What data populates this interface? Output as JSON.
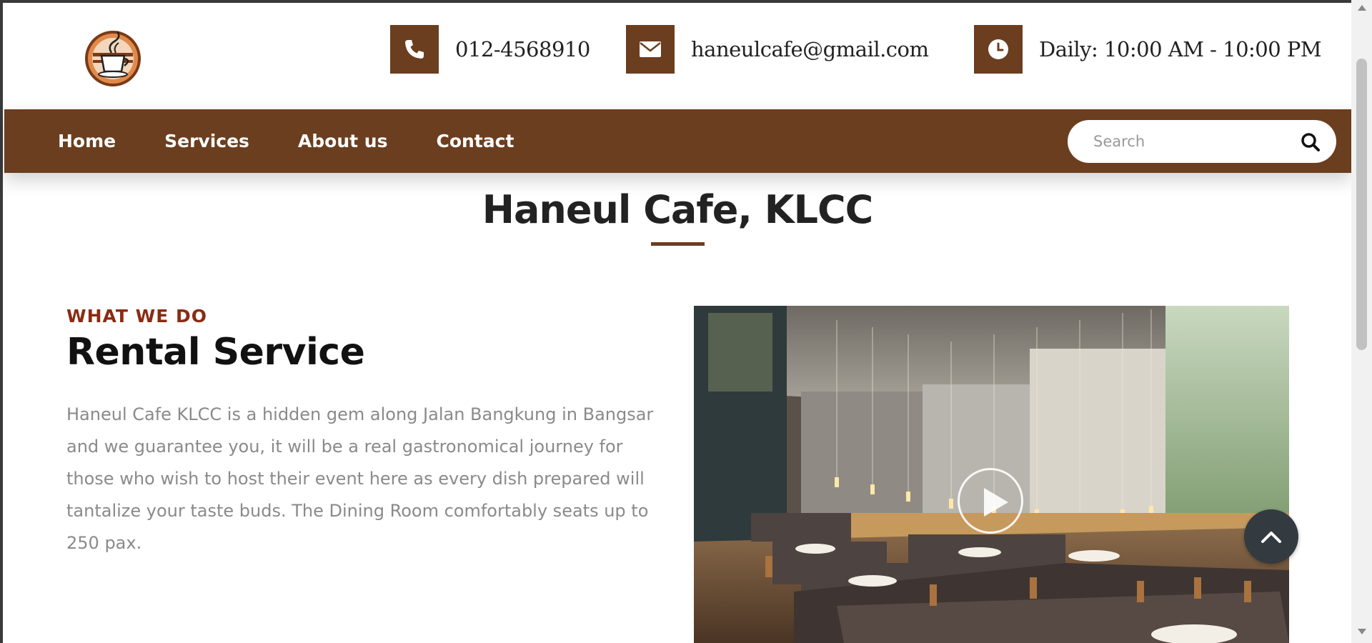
{
  "colors": {
    "brand_brown": "#6b3e1f",
    "eyebrow_red": "#8b2b12",
    "muted_text": "#8a8a8a"
  },
  "header": {
    "logo_icon": "coffee-cup-logo",
    "contacts": [
      {
        "icon": "phone-icon",
        "text": "012-4568910"
      },
      {
        "icon": "envelope-icon",
        "text": "haneulcafe@gmail.com"
      },
      {
        "icon": "clock-icon",
        "text": "Daily: 10:00 AM - 10:00 PM"
      }
    ]
  },
  "nav": {
    "items": [
      "Home",
      "Services",
      "About us",
      "Contact"
    ],
    "search_placeholder": "Search",
    "search_icon": "magnifier-icon"
  },
  "page": {
    "title": "Haneul Cafe, KLCC"
  },
  "section": {
    "eyebrow": "WHAT WE DO",
    "heading": "Rental Service",
    "description": "Haneul Cafe KLCC is a hidden gem along Jalan Bangkung in Bangsar and we guarantee you, it will be a real gastronomical journey for those who wish to host their event here as every dish prepared will tantalize your taste buds. The Dining Room comfortably seats up to 250 pax."
  },
  "media": {
    "play_icon": "play-icon",
    "back_to_top_icon": "chevron-up-icon"
  }
}
